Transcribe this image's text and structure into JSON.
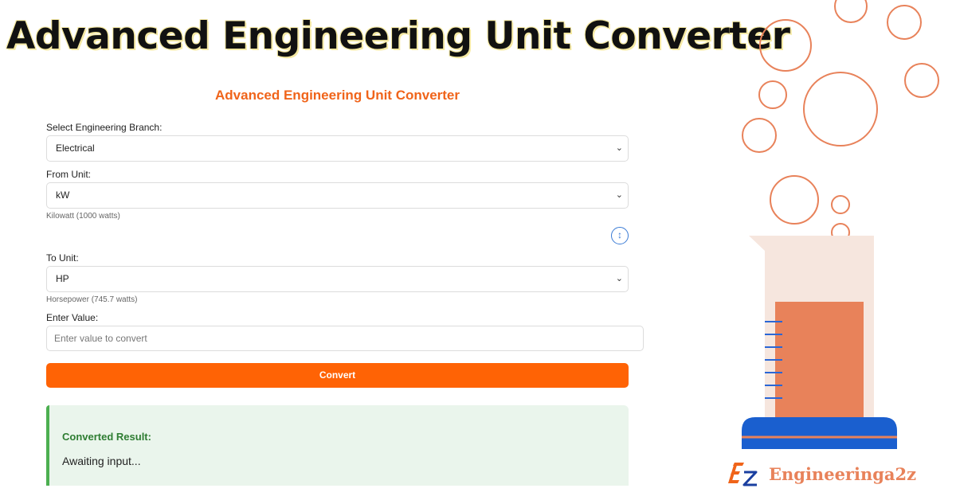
{
  "banner": {
    "title": "Advanced Engineering Unit Converter"
  },
  "app": {
    "title": "Advanced Engineering Unit Converter"
  },
  "branch": {
    "label": "Select Engineering Branch:",
    "selected": "Electrical"
  },
  "from_unit": {
    "label": "From Unit:",
    "selected": "kW",
    "description": "Kilowatt (1000 watts)"
  },
  "swap": {
    "icon": "swap-vertical-icon",
    "glyph": "↕"
  },
  "to_unit": {
    "label": "To Unit:",
    "selected": "HP",
    "description": "Horsepower (745.7 watts)"
  },
  "value_input": {
    "label": "Enter Value:",
    "value": "",
    "placeholder": "Enter value to convert"
  },
  "convert": {
    "label": "Convert"
  },
  "result": {
    "label": "Converted Result:",
    "text": "Awaiting input..."
  },
  "brand": {
    "name": "Engineeringa2z",
    "logo": "ez-logo-icon"
  },
  "colors": {
    "accent": "#ff6305",
    "title_orange": "#f0641a",
    "result_green": "#4caf50",
    "result_bg": "#eaf5ec",
    "swap_blue": "#3a7bd5",
    "illustration_orange": "#e8825a",
    "beaker_base_blue": "#1a5fcf"
  }
}
